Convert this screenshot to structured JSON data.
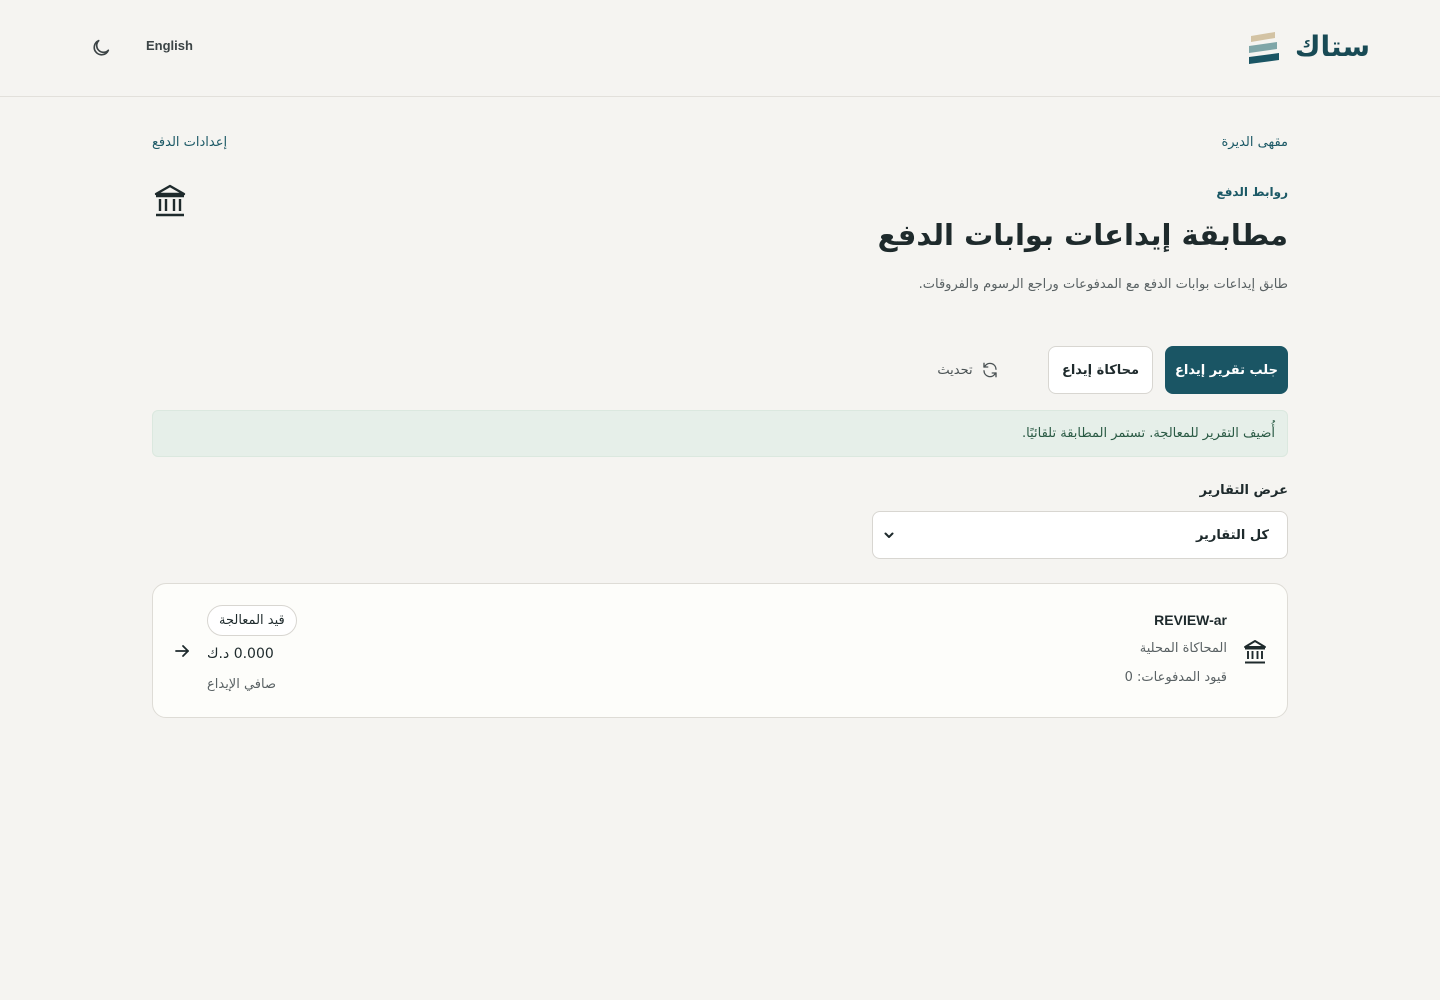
{
  "header": {
    "brand": "ستاك",
    "language_toggle": "English",
    "theme_icon": "moon-icon"
  },
  "breadcrumb": {
    "merchant": "مقهى الديرة",
    "settings_link": "إعدادات الدفع"
  },
  "page": {
    "eyebrow": "روابط الدفع",
    "title": "مطابقة إيداعات بوابات الدفع",
    "subtitle": "طابق إيداعات بوابات الدفع مع المدفوعات وراجع الرسوم والفروقات.",
    "hero_icon": "bank-icon"
  },
  "actions": {
    "fetch_report": "جلب تقرير إيداع",
    "simulate_deposit": "محاكاة إيداع",
    "refresh": "تحديث"
  },
  "alert": {
    "message": "أُضيف التقرير للمعالجة. تستمر المطابقة تلقائيًا."
  },
  "filter": {
    "label": "عرض التقارير",
    "selected": "كل التقارير"
  },
  "reports": [
    {
      "reference": "REVIEW-ar",
      "provider": "المحاكاة المحلية",
      "payment_entries": "قيود المدفوعات: 0",
      "status": "قيد المعالجة",
      "amount": "0.000 د.ك",
      "amount_label": "صافي الإيداع"
    }
  ],
  "colors": {
    "primary": "#1a5564",
    "background": "#f5f4f1",
    "alert_bg": "#e6efe9",
    "brand_accent": "#c8b89a"
  }
}
